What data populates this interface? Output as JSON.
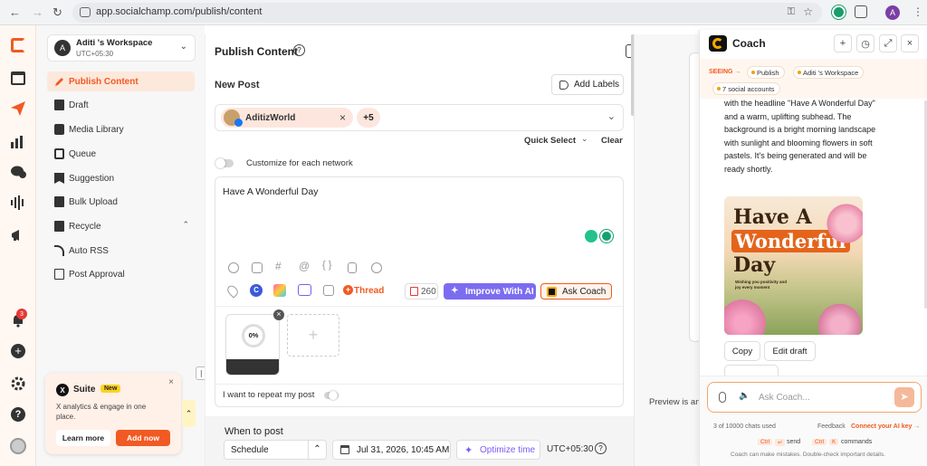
{
  "browser": {
    "url": "app.socialchamp.com/publish/content",
    "profile_initial": "A"
  },
  "rail": {
    "notification_count": "3"
  },
  "sidebar": {
    "workspace_name": "Aditi 's Workspace",
    "timezone": "UTC+05:30",
    "workspace_initial": "A",
    "items": [
      {
        "label": "Publish Content"
      },
      {
        "label": "Draft"
      },
      {
        "label": "Media Library"
      },
      {
        "label": "Queue"
      },
      {
        "label": "Suggestion"
      },
      {
        "label": "Bulk Upload"
      },
      {
        "label": "Recycle"
      },
      {
        "label": "Auto RSS"
      },
      {
        "label": "Post Approval"
      }
    ],
    "promo": {
      "title": "Suite",
      "badge": "New",
      "text": "X analytics & engage in one place.",
      "learn_more": "Learn more",
      "add_now": "Add now"
    }
  },
  "main": {
    "title": "Publish Content",
    "new_post": "New Post",
    "add_labels": "Add Labels",
    "account_name": "AditizWorld",
    "more_count": "+5",
    "quick_select": "Quick Select",
    "clear": "Clear",
    "customize": "Customize for each network",
    "post_text": "Have A Wonderful Day",
    "thread": "Thread",
    "char_count": "260",
    "improve_ai": "Improve With AI",
    "ask_coach": "Ask Coach",
    "upload_progress": "0%",
    "repeat_post": "I want to repeat my post",
    "when_to_post": "When to post",
    "schedule": "Schedule",
    "datetime": "Jul 31, 2026, 10:45 AM",
    "optimize_time": "Optimize time",
    "timezone": "UTC+05:30"
  },
  "preview": {
    "label": "Preview is an"
  },
  "coach": {
    "title": "Coach",
    "seeing_label": "SEEING →",
    "chips": [
      "Publish",
      "Aditi 's Workspace",
      "7 social accounts"
    ],
    "message": "with the headline \"Have A Wonderful Day\" and a warm, uplifting subhead. The background is a bright morning landscape with sunlight and blooming flowers in soft pastels. It's being generated and will be ready shortly.",
    "image": {
      "line1": "Have A",
      "line2": "Wonderful",
      "line3": "Day",
      "sub": "Wishing you positivity and joy every moment"
    },
    "copy": "Copy",
    "edit_draft": "Edit draft",
    "input_placeholder": "Ask Coach...",
    "usage": "3 of 10000 chats used",
    "feedback": "Feedback",
    "connect_key": "Connect your AI key →",
    "send_key": "Ctrl",
    "send_key2": "↵",
    "send_label": "send",
    "cmd_key": "Ctrl",
    "cmd_key2": "K",
    "cmd_label": "commands",
    "disclaimer": "Coach can make mistakes. Double-check important details."
  },
  "colors": {
    "accent": "#f15a22",
    "purple": "#7c5cf5",
    "coach_yellow": "#f2a900"
  }
}
